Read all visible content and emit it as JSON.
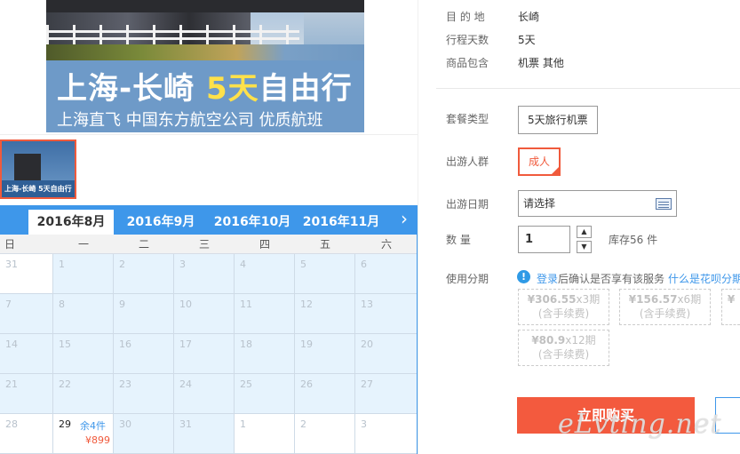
{
  "banner": {
    "title_prefix": "上海-长崎 ",
    "title_highlight": "5天",
    "title_suffix": "自由行",
    "subtitle": "上海直飞 中国东方航空公司 优质航班"
  },
  "thumbnail": {
    "caption": "上海-长崎 5天自由行"
  },
  "calendar": {
    "months": [
      {
        "label": "2016年8月",
        "active": true
      },
      {
        "label": "2016年9月",
        "active": false
      },
      {
        "label": "2016年10月",
        "active": false
      },
      {
        "label": "2016年11月",
        "active": false
      }
    ],
    "next_label": "›",
    "weekdays": [
      "日",
      "一",
      "二",
      "三",
      "四",
      "五",
      "六"
    ],
    "rows": [
      [
        {
          "n": "31",
          "w": true
        },
        {
          "n": "1"
        },
        {
          "n": "2"
        },
        {
          "n": "3"
        },
        {
          "n": "4"
        },
        {
          "n": "5"
        },
        {
          "n": "6"
        }
      ],
      [
        {
          "n": "7"
        },
        {
          "n": "8"
        },
        {
          "n": "9"
        },
        {
          "n": "10"
        },
        {
          "n": "11"
        },
        {
          "n": "12"
        },
        {
          "n": "13"
        }
      ],
      [
        {
          "n": "14"
        },
        {
          "n": "15"
        },
        {
          "n": "16"
        },
        {
          "n": "17"
        },
        {
          "n": "18"
        },
        {
          "n": "19"
        },
        {
          "n": "20"
        }
      ],
      [
        {
          "n": "21"
        },
        {
          "n": "22"
        },
        {
          "n": "23"
        },
        {
          "n": "24"
        },
        {
          "n": "25"
        },
        {
          "n": "26"
        },
        {
          "n": "27"
        }
      ],
      [
        {
          "n": "28",
          "w": true
        },
        {
          "n": "29",
          "w": true,
          "avail": true,
          "stock": "余4件",
          "price": "¥899"
        },
        {
          "n": "30"
        },
        {
          "n": "31"
        },
        {
          "n": "1",
          "w": true
        },
        {
          "n": "2",
          "w": true
        },
        {
          "n": "3",
          "w": true
        }
      ]
    ]
  },
  "info": {
    "destination_label": "目 的 地",
    "destination_value": "长崎",
    "days_label": "行程天数",
    "days_value": "5天",
    "includes_label": "商品包含",
    "includes_value": "机票  其他"
  },
  "options": {
    "package_label": "套餐类型",
    "package_value": "5天旅行机票",
    "group_label": "出游人群",
    "group_value": "成人",
    "date_label": "出游日期",
    "date_value": "请选择",
    "qty_label": "数    量",
    "qty_value": "1",
    "stock_text": "库存56 件",
    "installment_label": "使用分期",
    "installment_login": "登录",
    "installment_notice": "后确认是否享有该服务",
    "installment_question": "什么是花呗分期",
    "plans": [
      {
        "amount": "¥306.55",
        "periods": "x3期",
        "fee": "(含手续费)"
      },
      {
        "amount": "¥156.57",
        "periods": "x6期",
        "fee": "(含手续费)"
      },
      {
        "amount": "¥",
        "periods": "",
        "fee": ""
      },
      {
        "amount": "¥80.9",
        "periods": "x12期",
        "fee": "(含手续费)"
      }
    ]
  },
  "actions": {
    "buy_label": "立即购买"
  },
  "watermark": "eLvting.net",
  "colors": {
    "accent_blue": "#3e97ea",
    "accent_red": "#f05a3c",
    "buy_button": "#f35a3e"
  }
}
